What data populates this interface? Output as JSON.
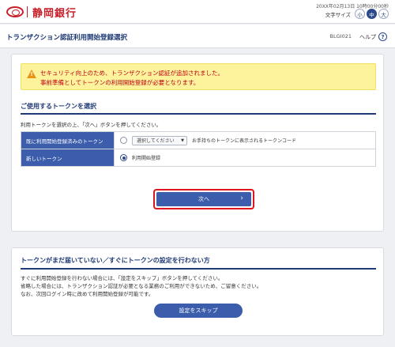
{
  "header": {
    "bank_name": "静岡銀行",
    "datetime": "20XX年02月13日 10時00分00秒",
    "font_size_label": "文字サイズ",
    "font_sizes": [
      "小",
      "中",
      "大"
    ],
    "active_font_size": "中"
  },
  "titlebar": {
    "title": "トランザクション認証利用開始登録選択",
    "screen_id": "BLGI021",
    "help_label": "ヘルプ",
    "help_icon": "?"
  },
  "alert": {
    "icon": "!",
    "line1": "セキュリティ向上のため、トランザクション認証が追加されました。",
    "line2": "事前準備としてトークンの利用開始登録が必要となります。"
  },
  "token_section": {
    "title": "ご使用するトークンを選択",
    "instruction": "利用トークンを選択の上、「次へ」ボタンを押してください。",
    "rows": [
      {
        "label": "既に利用開始登録済みのトークン",
        "select_value": "選択してください",
        "select_arrow": "▼",
        "text": "お手持ちのトークンに表示されるトークンコード",
        "checked": false
      },
      {
        "label": "新しいトークン",
        "text": "利用開始登録",
        "checked": true
      }
    ],
    "next_button": "次へ",
    "next_chevron": "›"
  },
  "skip_section": {
    "title": "トークンがまだ届いていない／すぐにトークンの設定を行わない方",
    "lines": [
      "すぐに利用開始登録を行わない場合には、「設定をスキップ」ボタンを押してください。",
      "省略した場合には、トランザクション認証が必要となる業務のご利用ができないため、ご留意ください。",
      "なお、次回ログイン時に改めて利用開始登録が可能です。"
    ],
    "skip_button": "設定をスキップ"
  },
  "colors": {
    "brand_red": "#c8202a",
    "navy": "#1f3a75",
    "button_blue": "#3b5dab",
    "alert_yellow": "#fdf39c",
    "alert_text": "#c00010",
    "highlight_red": "#e0141c"
  }
}
